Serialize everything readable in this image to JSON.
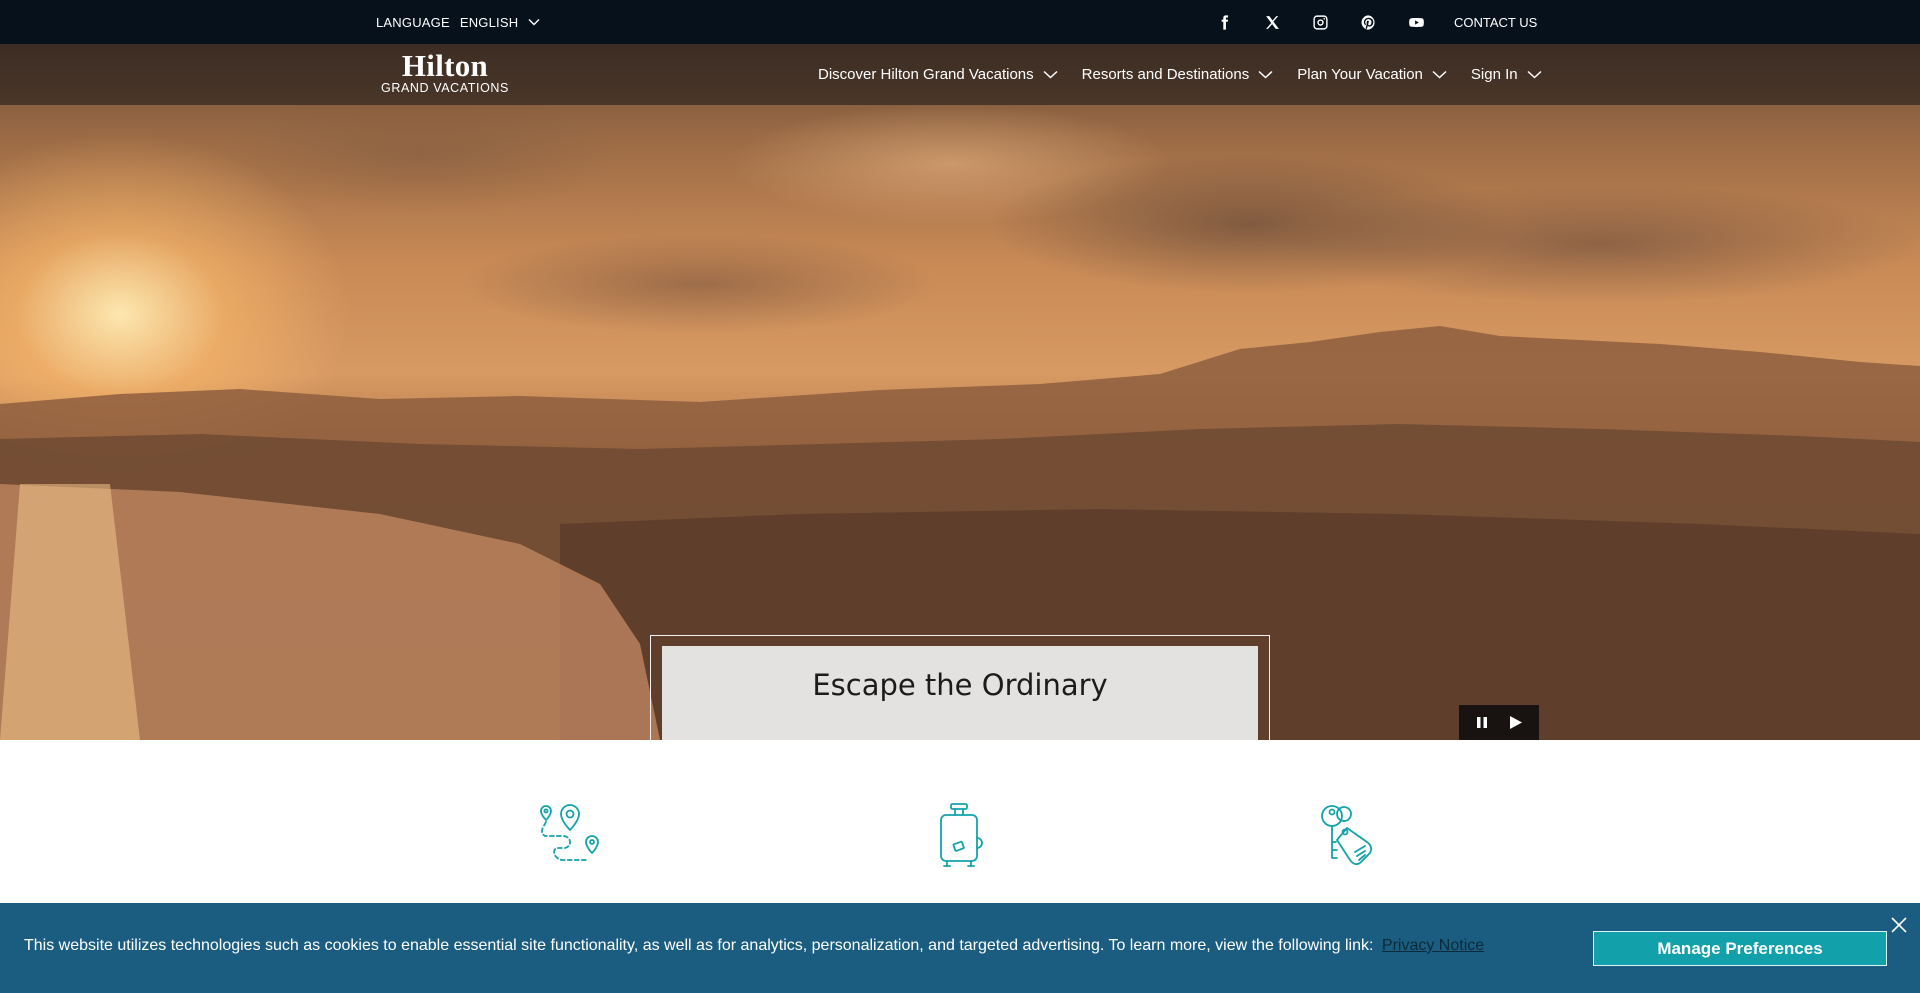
{
  "utility_bar": {
    "language_label": "LANGUAGE",
    "language_value": "ENGLISH",
    "socials": [
      {
        "name": "facebook-icon"
      },
      {
        "name": "x-twitter-icon"
      },
      {
        "name": "instagram-icon"
      },
      {
        "name": "pinterest-icon"
      },
      {
        "name": "youtube-icon"
      }
    ],
    "contact_label": "CONTACT US"
  },
  "header": {
    "logo_main": "Hilton",
    "logo_sub": "GRAND VACATIONS",
    "nav": [
      {
        "label": "Discover Hilton Grand Vacations"
      },
      {
        "label": "Resorts and Destinations"
      },
      {
        "label": "Plan Your Vacation"
      },
      {
        "label": "Sign In"
      }
    ]
  },
  "hero": {
    "caption_title": "Escape the Ordinary",
    "controls": [
      "pause-icon",
      "play-icon"
    ]
  },
  "features": {
    "icons": [
      "map-route-icon",
      "suitcase-icon",
      "keys-tag-icon"
    ],
    "icon_color": "#12a3ab"
  },
  "cookie_banner": {
    "text": "This website utilizes technologies such as cookies to enable essential site functionality, as well as for analytics, personalization, and targeted advertising. To learn more, view the following link:",
    "link_label": "Privacy Notice",
    "button_label": "Manage Preferences",
    "background_color": "#1b5d80",
    "button_color": "#12a0aa"
  }
}
